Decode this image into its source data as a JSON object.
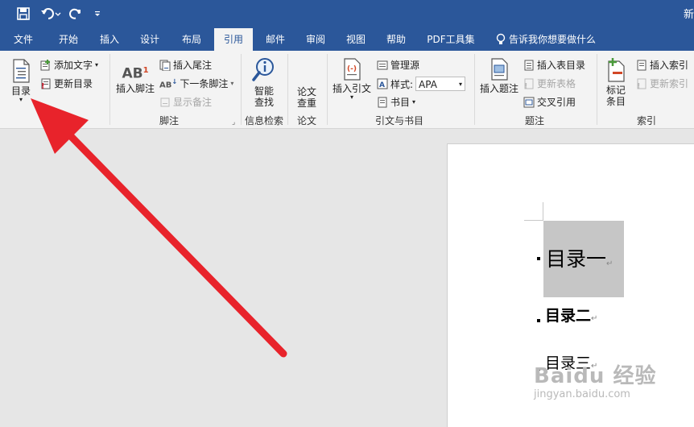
{
  "app": {
    "doc_title": "新",
    "colors": {
      "title_bar": "#2b579a",
      "ribbon": "#f3f3f3",
      "accent_red": "#e8232b"
    }
  },
  "qat": {
    "save_icon": "save-icon",
    "undo_icon": "undo-icon",
    "redo_icon": "redo-icon",
    "customize_icon": "customize-qat-icon"
  },
  "tabs": [
    "文件",
    "开始",
    "插入",
    "设计",
    "布局",
    "引用",
    "邮件",
    "审阅",
    "视图",
    "帮助",
    "PDF工具集"
  ],
  "active_tab": "引用",
  "tell_me": "告诉我你想要做什么",
  "ribbon": {
    "toc": {
      "group": "录",
      "big_label": "目录",
      "add_text": "添加文字",
      "update_toc": "更新目录"
    },
    "footnotes": {
      "group": "脚注",
      "insert_footnote": "插入脚注",
      "insert_endnote": "插入尾注",
      "next_footnote": "下一条脚注",
      "show_notes": "显示备注",
      "ab_glyph": "AB"
    },
    "research": {
      "group": "信息检索",
      "smart_lookup_1": "智能",
      "smart_lookup_2": "查找"
    },
    "paper": {
      "group": "论文",
      "label_1": "论文",
      "label_2": "查重"
    },
    "citations": {
      "group": "引文与书目",
      "insert_citation": "插入引文",
      "manage_sources": "管理源",
      "style_label": "样式:",
      "style_value": "APA",
      "bibliography": "书目"
    },
    "captions": {
      "group": "题注",
      "insert_caption": "插入题注",
      "insert_table_of_figures": "插入表目录",
      "update_table": "更新表格",
      "cross_reference": "交叉引用"
    },
    "index": {
      "group": "索引",
      "mark_entry_1": "标记",
      "mark_entry_2": "条目",
      "insert_index": "插入索引",
      "update_index": "更新索引"
    }
  },
  "document": {
    "headings": [
      "目录一",
      "目录二",
      "目录三"
    ],
    "paragraph_mark": "↵"
  },
  "watermark": {
    "brand": "Baidu 经验",
    "url": "jingyan.baidu.com"
  }
}
